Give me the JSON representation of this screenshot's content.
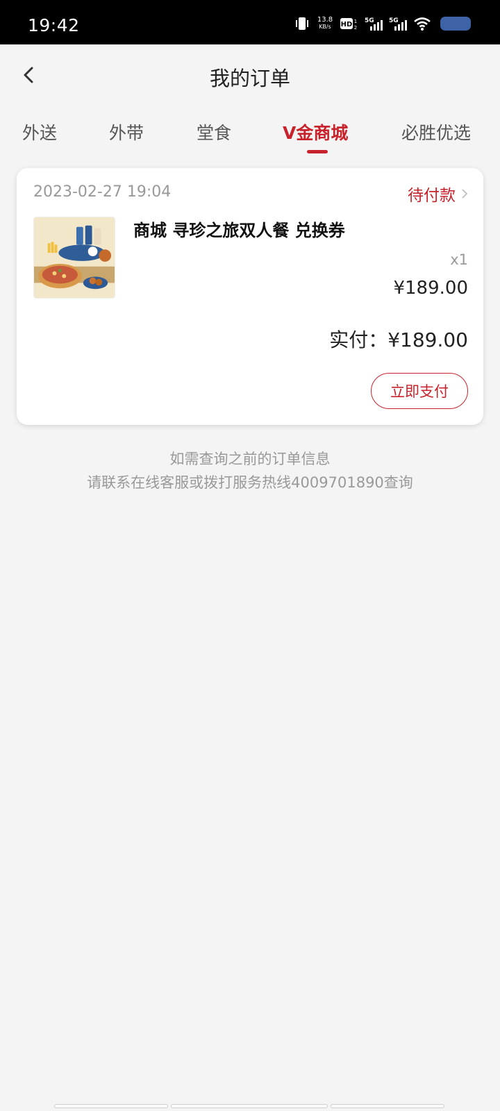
{
  "status_bar": {
    "time": "19:42",
    "network_speed_value": "13.8",
    "network_speed_unit": "KB/s",
    "hd_label": "HD",
    "sim1_label": "5G",
    "sim2_label": "5G",
    "icons": [
      "vibrate-icon",
      "hd-icon",
      "signal-icon",
      "signal-icon",
      "wifi-icon",
      "battery-icon"
    ]
  },
  "header": {
    "title": "我的订单",
    "back_icon": "chevron-left-icon"
  },
  "tabs": [
    {
      "label": "外送",
      "active": false
    },
    {
      "label": "外带",
      "active": false
    },
    {
      "label": "堂食",
      "active": false
    },
    {
      "label": "V金商城",
      "active": true
    },
    {
      "label": "必胜优选",
      "active": false
    }
  ],
  "order": {
    "date": "2023-02-27 19:04",
    "status": "待付款",
    "product_name": "商城 寻珍之旅双人餐 兑换券",
    "quantity": "x1",
    "price": "¥189.00",
    "paid_label": "实付：¥189.00",
    "pay_button": "立即支付"
  },
  "notice": {
    "line1": "如需查询之前的订单信息",
    "line2": "请联系在线客服或拨打服务热线4009701890查询"
  },
  "colors": {
    "accent": "#c8232c",
    "background": "#f4f4f4",
    "muted": "#999999"
  }
}
